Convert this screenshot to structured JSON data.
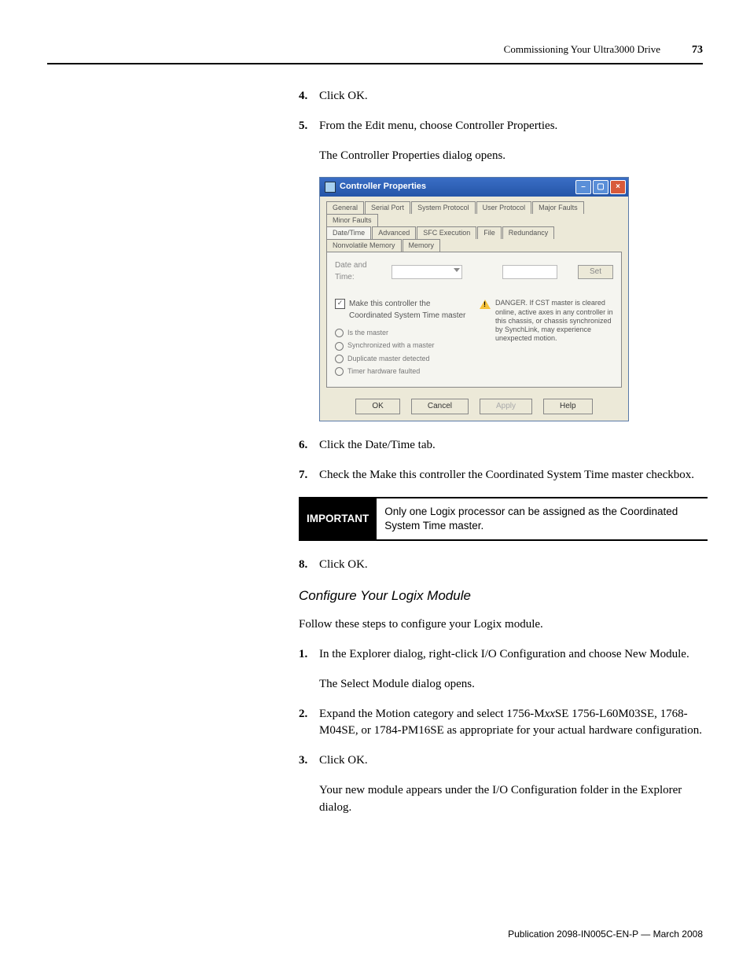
{
  "header": {
    "section": "Commissioning Your Ultra3000 Drive",
    "page": "73"
  },
  "steps": {
    "s4": {
      "n": "4.",
      "t": "Click OK."
    },
    "s5": {
      "n": "5.",
      "t": "From the Edit menu, choose Controller Properties.",
      "sub": "The Controller Properties dialog opens."
    },
    "s6": {
      "n": "6.",
      "t": "Click the Date/Time tab."
    },
    "s7": {
      "n": "7.",
      "t": "Check the Make this controller the Coordinated System Time master checkbox."
    },
    "s8": {
      "n": "8.",
      "t": "Click OK."
    }
  },
  "important": {
    "label": "IMPORTANT",
    "text": "Only one Logix processor can be assigned as the Coordinated System Time master."
  },
  "subhead": "Configure Your Logix Module",
  "intro": "Follow these steps to configure your Logix module.",
  "cfg": {
    "s1": {
      "n": "1.",
      "t": "In the Explorer dialog, right-click I/O Configuration and choose New Module.",
      "sub": "The Select Module dialog opens."
    },
    "s2": {
      "n": "2.",
      "pre": "Expand the Motion category and select 1756-M",
      "it": "xx",
      "post": "SE 1756-L60M03SE, 1768-M04SE, or 1784-PM16SE as appropriate for your actual hardware configuration."
    },
    "s3": {
      "n": "3.",
      "t": "Click OK.",
      "sub": "Your new module appears under the I/O Configuration folder in the Explorer dialog."
    }
  },
  "dialog": {
    "title": "Controller Properties",
    "tabs_row1": [
      "General",
      "Serial Port",
      "System Protocol",
      "User Protocol",
      "Major Faults",
      "Minor Faults"
    ],
    "tabs_row2": [
      "Date/Time",
      "Advanced",
      "SFC Execution",
      "File",
      "Redundancy",
      "Nonvolatile Memory",
      "Memory"
    ],
    "date_label": "Date and Time:",
    "set_btn": "Set",
    "chk_label": "Make this controller the Coordinated System Time master",
    "status": [
      "Is the master",
      "Synchronized with a master",
      "Duplicate master detected",
      "Timer hardware faulted"
    ],
    "warning": "DANGER. If CST master is cleared online, active axes in any controller in this chassis, or chassis synchronized by SynchLink, may experience unexpected motion.",
    "buttons": {
      "ok": "OK",
      "cancel": "Cancel",
      "apply": "Apply",
      "help": "Help"
    }
  },
  "footer": "Publication 2098-IN005C-EN-P — March 2008"
}
